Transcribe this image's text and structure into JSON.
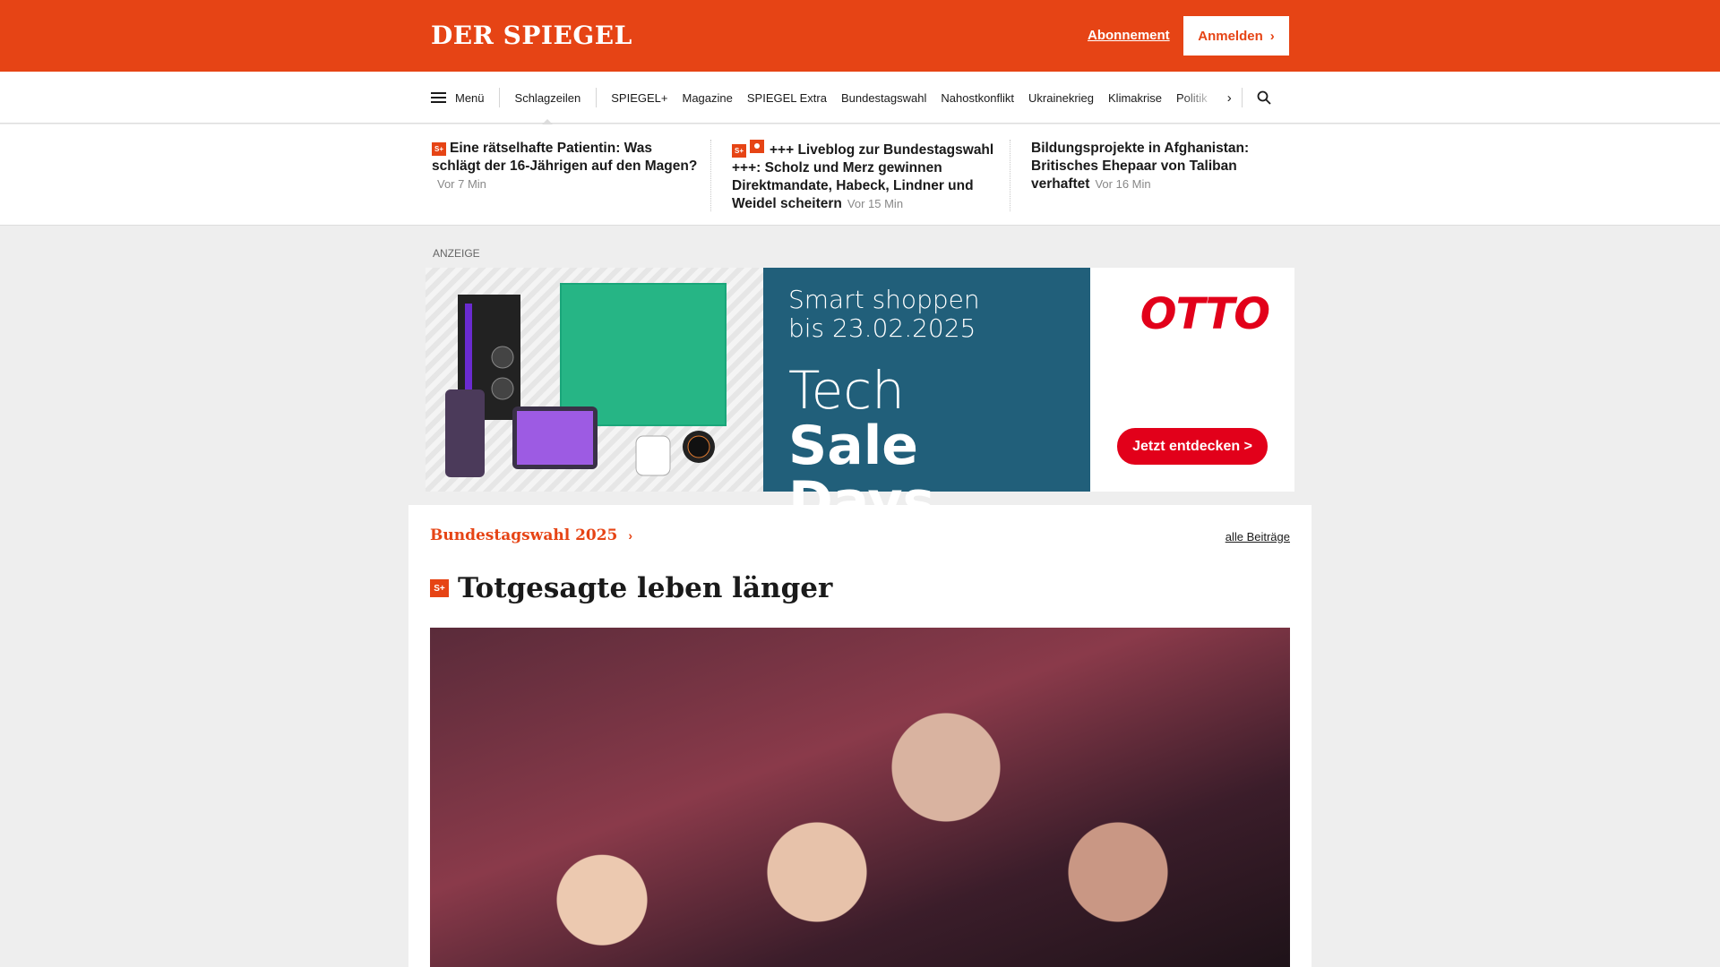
{
  "header": {
    "logo": "DER SPIEGEL",
    "abo_label": "Abonnement",
    "login_label": "Anmelden",
    "brand_color": "#e64415"
  },
  "nav": {
    "menu_label": "Menü",
    "active_label": "Schlagzeilen",
    "items": [
      "SPIEGEL+",
      "Magazine",
      "SPIEGEL Extra",
      "Bundestagswahl",
      "Nahostkonflikt",
      "Ukrainekrieg",
      "Klimakrise",
      "Politik"
    ],
    "next_icon": "chevron-right-icon",
    "search_icon": "search-icon"
  },
  "teasers": [
    {
      "badge": "S+",
      "title": "Eine rätselhafte Patientin: Was schlägt der 16-Jährigen auf den Magen?",
      "time": "Vor 7 Min"
    },
    {
      "badge": "S+",
      "live": true,
      "title": "+++ Liveblog zur Bundestagswahl +++: Scholz und Merz gewinnen Direktmandate, Habeck, Lindner und Weidel scheitern",
      "time": "Vor 15 Min"
    },
    {
      "title": "Bildungsprojekte in Afghanistan: Britisches Ehepaar von Taliban verhaftet",
      "time": "Vor 16 Min"
    }
  ],
  "ad": {
    "label": "ANZEIGE",
    "line1": "Smart shoppen",
    "line2": "bis 23.02.2025",
    "line3": "Tech",
    "line4": "Sale Days",
    "brand": "OTTO",
    "cta": "Jetzt entdecken >",
    "bg_color": "#215f7a",
    "brand_color": "#e2001a"
  },
  "main": {
    "section_label": "Bundestagswahl 2025",
    "all_label": "alle Beiträge",
    "badge": "S+",
    "headline": "Totgesagte leben länger"
  }
}
